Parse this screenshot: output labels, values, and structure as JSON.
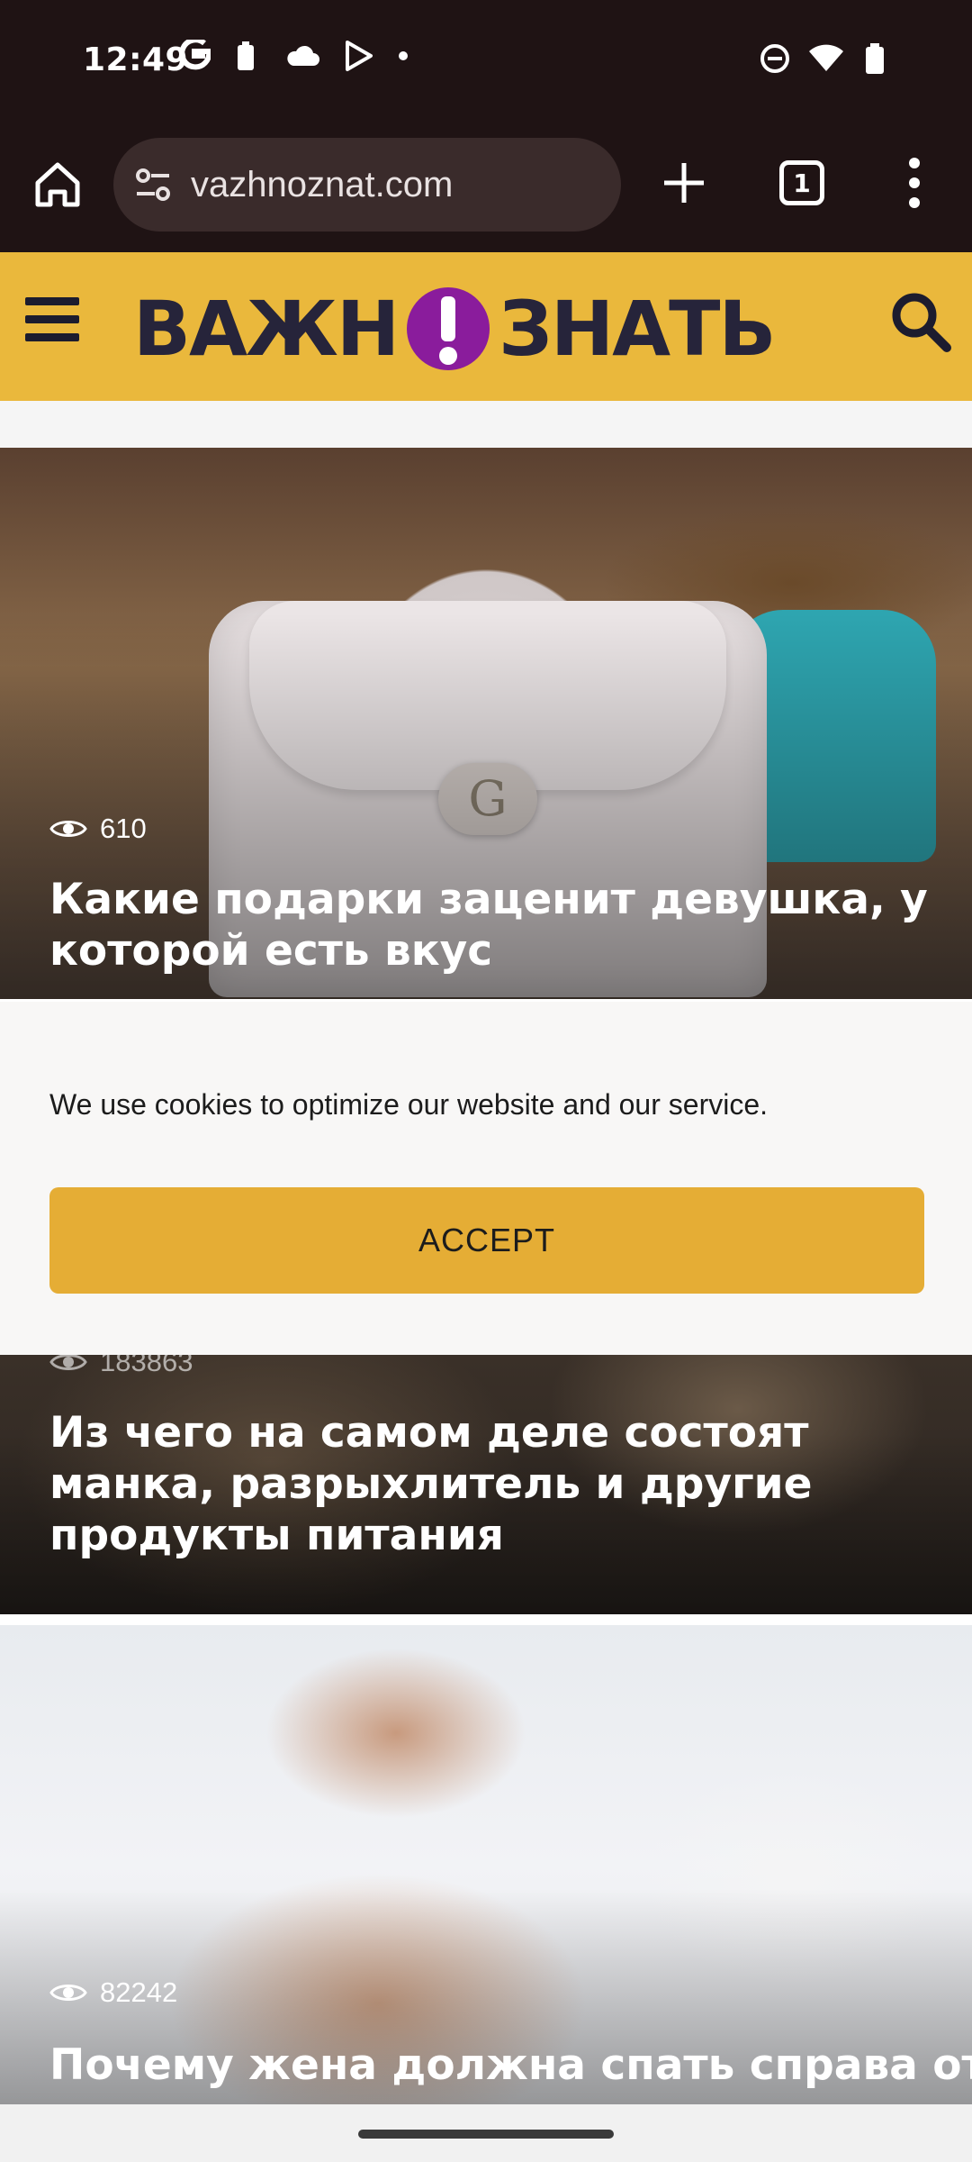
{
  "status_bar": {
    "time": "12:49",
    "left_icons": [
      "google-icon",
      "battery-saver-icon",
      "cloud-icon",
      "play-store-icon",
      "dot-icon"
    ],
    "right_icons": [
      "dnd-icon",
      "wifi-icon",
      "battery-icon"
    ]
  },
  "browser": {
    "url": "vazhnoznat.com",
    "tab_count": "1"
  },
  "site": {
    "logo_left": "ВАЖН",
    "logo_right": "ЗНАТЬ",
    "brand_color": "#eab83c",
    "logo_accent": "#8a1c9c"
  },
  "articles": [
    {
      "views": "610",
      "title": "Какие подарки заценит девушка, у которой есть вкус"
    },
    {
      "views": "183863",
      "title": "Из чего на самом деле состоят манка, разрыхлитель и другие продукты питания"
    },
    {
      "views": "82242",
      "title": "Почему жена должна спать справа от"
    }
  ],
  "cookie": {
    "message": "We use cookies to optimize our website and our service.",
    "accept_label": "ACCEPT",
    "accept_color": "#e5ad35"
  },
  "bag_clasp_letter": "G"
}
